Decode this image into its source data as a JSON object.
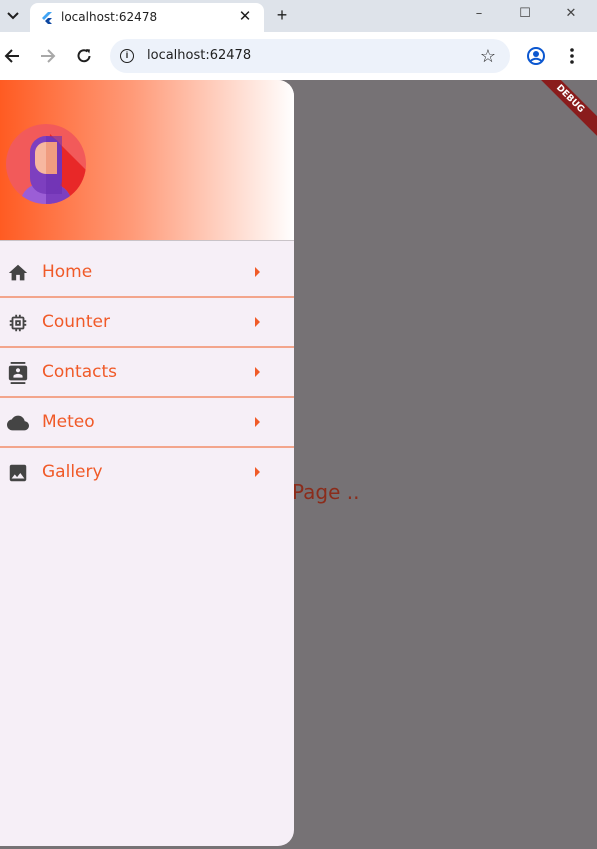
{
  "browser": {
    "tab_title": "localhost:62478",
    "url": "localhost:62478",
    "window_controls": {
      "minimize": "–",
      "maximize": "☐",
      "close": "✕"
    }
  },
  "app": {
    "body_text": "Page ..",
    "debug_banner": "DEBUG",
    "accent_color": "#f05a28",
    "menu": [
      {
        "label": "Home",
        "icon": "home-icon"
      },
      {
        "label": "Counter",
        "icon": "chip-icon"
      },
      {
        "label": "Contacts",
        "icon": "contacts-icon"
      },
      {
        "label": "Meteo",
        "icon": "cloud-icon"
      },
      {
        "label": "Gallery",
        "icon": "image-icon"
      }
    ]
  }
}
